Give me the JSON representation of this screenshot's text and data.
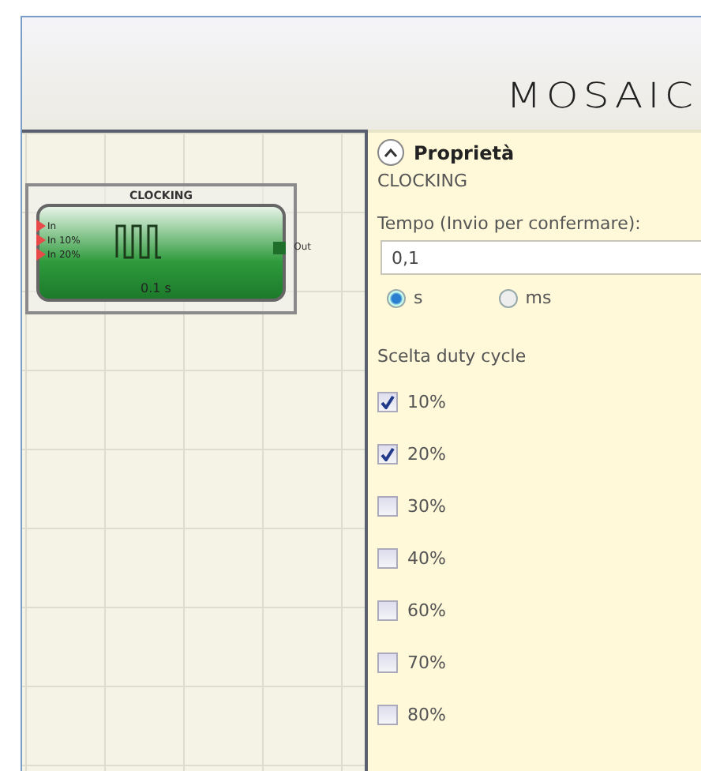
{
  "logo": "MOSAIC",
  "canvas": {
    "block": {
      "title": "CLOCKING",
      "inputs": [
        "In",
        "In 10%",
        "In 20%"
      ],
      "output": "Out",
      "value": "0.1 s"
    }
  },
  "properties": {
    "title": "Proprietà",
    "expanded": true,
    "block_name": "CLOCKING",
    "time_label": "Tempo (Invio per confermare):",
    "time_value": "0,1",
    "units": [
      {
        "label": "s",
        "selected": true
      },
      {
        "label": "ms",
        "selected": false
      }
    ],
    "duty_label": "Scelta duty cycle",
    "duty_cycles": [
      {
        "label": "10%",
        "checked": true
      },
      {
        "label": "20%",
        "checked": true
      },
      {
        "label": "30%",
        "checked": false
      },
      {
        "label": "40%",
        "checked": false
      },
      {
        "label": "60%",
        "checked": false
      },
      {
        "label": "70%",
        "checked": false
      },
      {
        "label": "80%",
        "checked": false
      }
    ]
  }
}
